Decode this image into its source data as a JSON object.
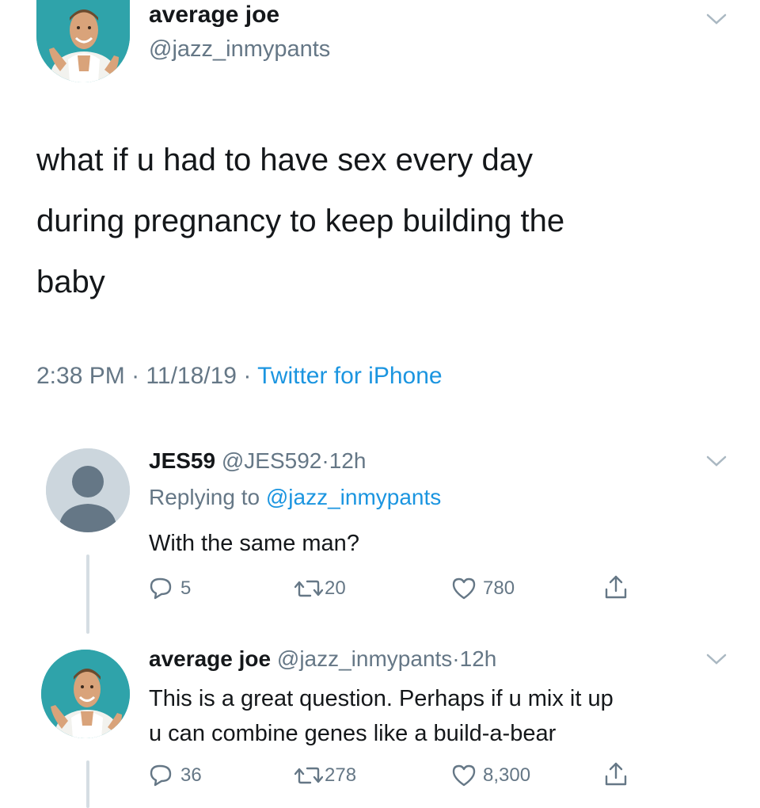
{
  "main_tweet": {
    "name": "average joe",
    "handle": "@jazz_inmypants",
    "text_lines": [
      "what if u had to have sex every day",
      "during pregnancy to keep building the",
      "baby"
    ],
    "time": "2:38 PM",
    "date": "11/18/19",
    "separator": "·",
    "source": "Twitter for iPhone"
  },
  "reply1": {
    "name": "JES59",
    "handle": "@JES592",
    "time": "12h",
    "separator": "·",
    "replying_prefix": "Replying to",
    "replying_handle": "@jazz_inmypants",
    "text": "With the same man?",
    "replies": "5",
    "retweets": "20",
    "likes": "780"
  },
  "reply2": {
    "name": "average joe",
    "handle": "@jazz_inmypants",
    "time": "12h",
    "separator": "·",
    "text_lines": [
      "This is a great question. Perhaps if u mix it up",
      "u can combine genes like a build-a-bear"
    ],
    "replies": "36",
    "retweets": "278",
    "likes": "8,300"
  },
  "colors": {
    "text": "#14171a",
    "secondary": "#657786",
    "link": "#1b95e0",
    "avatar_bg": "#2fa3aa",
    "default_avatar_bg": "#ccd6dd"
  }
}
